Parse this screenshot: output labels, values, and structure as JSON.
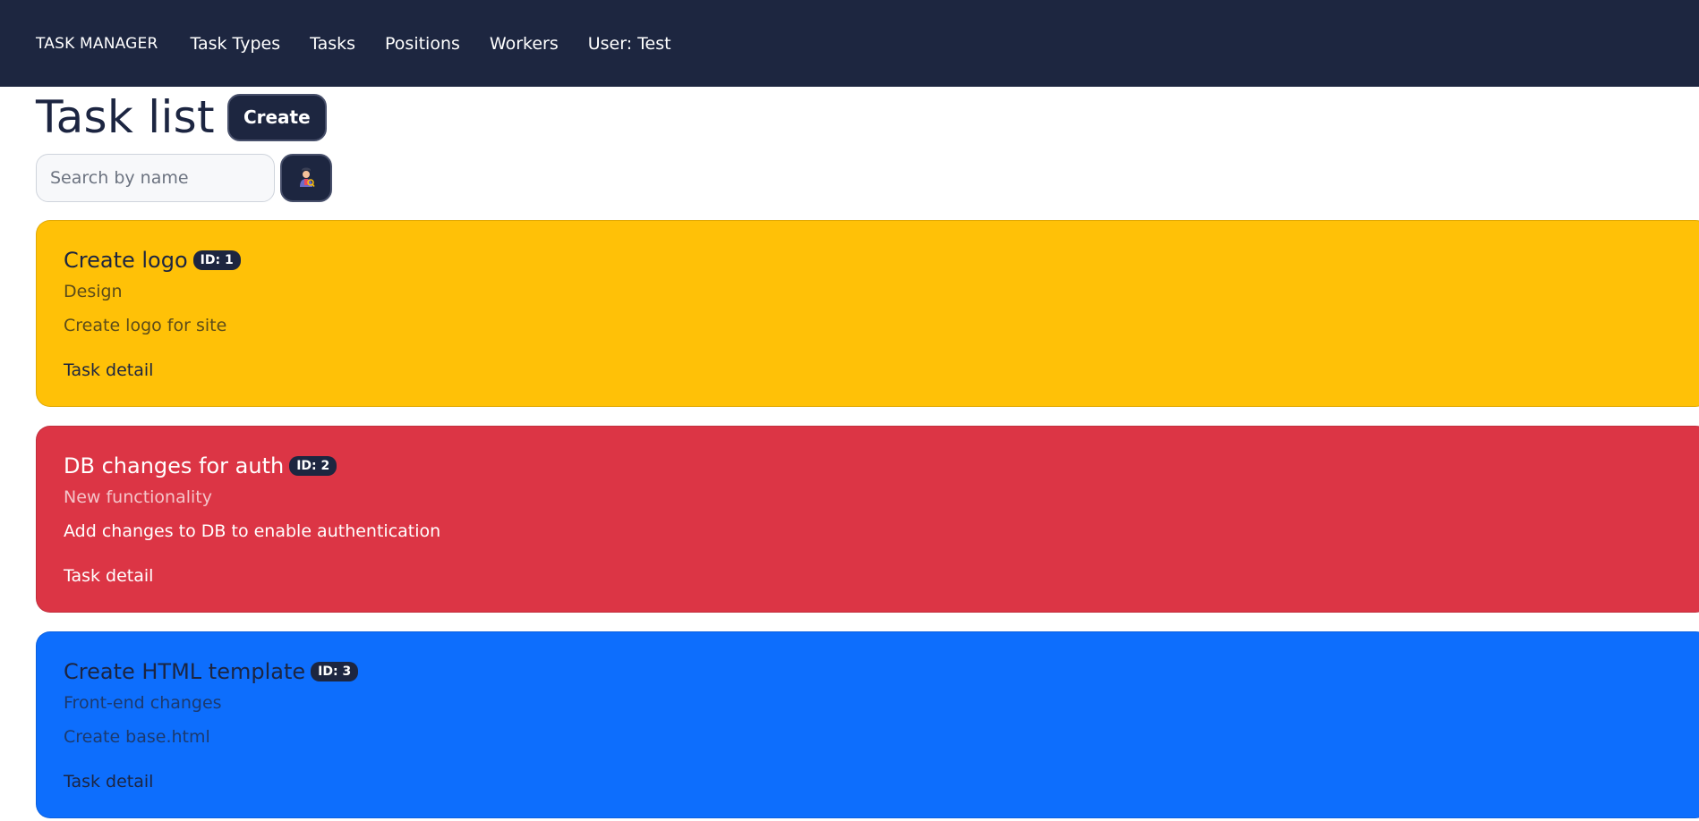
{
  "navbar": {
    "brand": "TASK MANAGER",
    "links": [
      "Task Types",
      "Tasks",
      "Positions",
      "Workers",
      "User: Test"
    ]
  },
  "page": {
    "title": "Task list",
    "create_label": "Create"
  },
  "search": {
    "placeholder": "Search by name",
    "value": "",
    "button_icon": "search-person-icon"
  },
  "tasks": [
    {
      "name": "Create logo",
      "badge": "ID: 1",
      "type": "Design",
      "description": "Create logo for site",
      "link": "Task detail",
      "bg_color": "#ffc107",
      "title_color": "#1c2541",
      "subtitle_color": "#5c4c1a",
      "text_color": "#5c4c1a"
    },
    {
      "name": "DB changes for auth",
      "badge": "ID: 2",
      "type": "New functionality",
      "description": "Add changes to DB to enable authentication",
      "link": "Task detail",
      "bg_color": "#dc3545",
      "title_color": "#ffffff",
      "subtitle_color": "#f4c4c9",
      "text_color": "#ffffff"
    },
    {
      "name": "Create HTML template",
      "badge": "ID: 3",
      "type": "Front-end changes",
      "description": "Create base.html",
      "link": "Task detail",
      "bg_color": "#0d6efd",
      "title_color": "#1c2541",
      "subtitle_color": "#1c3a6e",
      "text_color": "#1c3a6e"
    }
  ]
}
